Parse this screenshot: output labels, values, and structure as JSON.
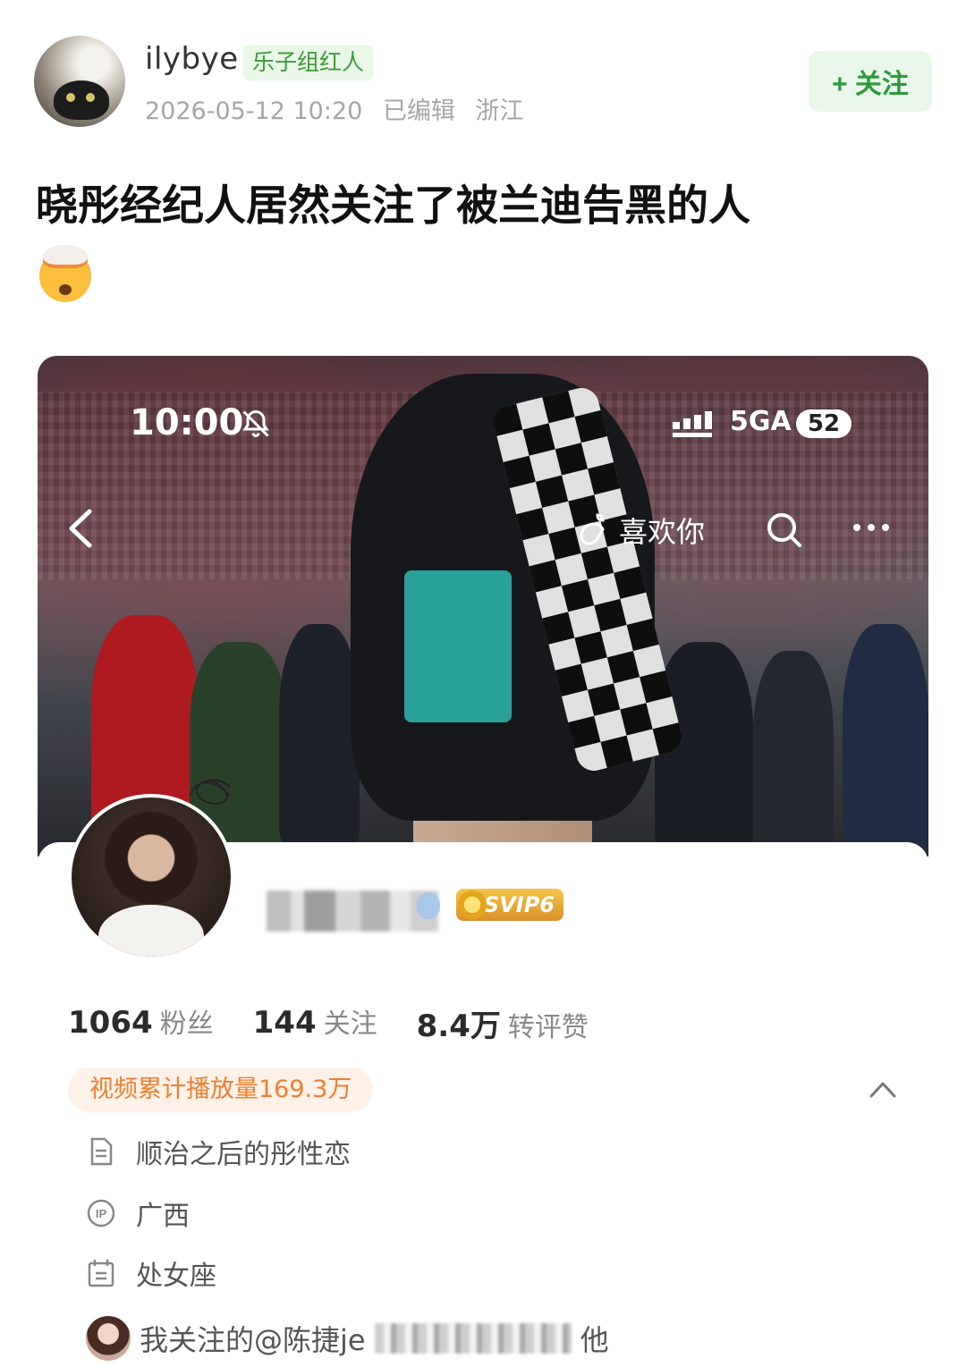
{
  "post": {
    "username": "ilybye",
    "badge": "乐子组红人",
    "date": "2026-05-12 10:20",
    "edited": "已编辑",
    "location": "浙江",
    "follow_label": "+ 关注",
    "title": "晓彤经纪人居然关注了被兰迪告黑的人",
    "emoji": "exploding-head-emoji"
  },
  "screenshot": {
    "status_bar": {
      "time": "10:00",
      "network": "5GA",
      "battery": "52"
    },
    "nav": {
      "like_label": "喜欢你"
    },
    "profile": {
      "name_blurred": "████",
      "vip_badge": "SVIP6",
      "stats": [
        {
          "value": "1064",
          "label": "粉丝"
        },
        {
          "value": "144",
          "label": "关注"
        },
        {
          "value": "8.4万",
          "label": "转评赞"
        }
      ],
      "play_count": "视频累计播放量169.3万",
      "bio": "顺治之后的彤性恋",
      "ip": "广西",
      "zodiac": "处女座",
      "mutual_prefix": "我关注的@陈捷je",
      "mutual_suffix": "他"
    }
  },
  "colors": {
    "follow_green": "#2f9a3c",
    "badge_green_bg": "#e8f7e6",
    "play_orange": "#ef7e2f",
    "play_bg": "#fdf1e8",
    "svip_gold": "#f6c54a"
  }
}
